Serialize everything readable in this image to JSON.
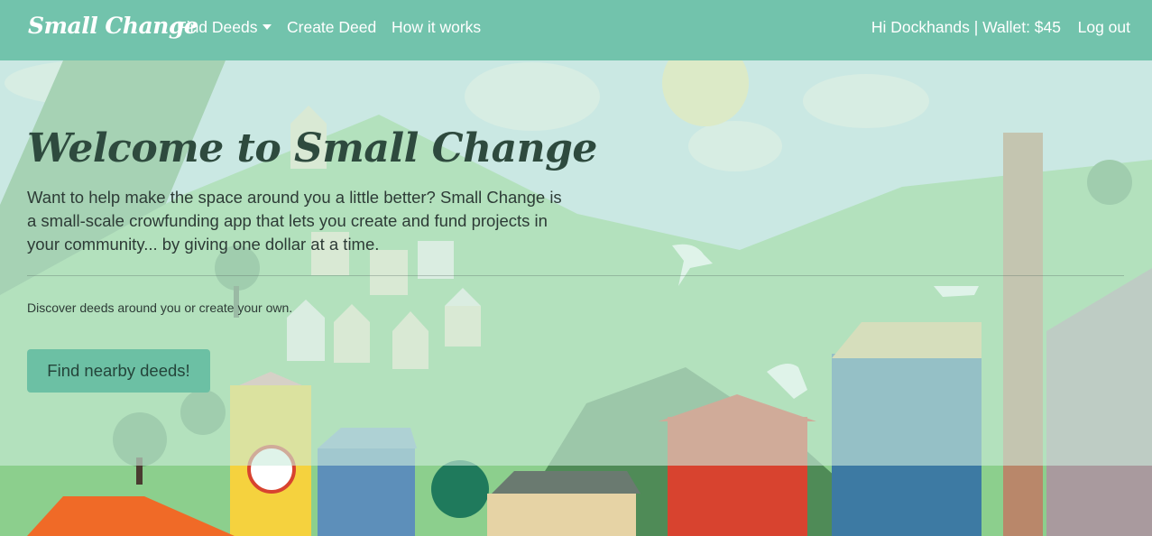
{
  "navbar": {
    "brand": "Small Change",
    "find_deeds": "Find Deeds",
    "create_deed": "Create Deed",
    "how_it_works": "How it works",
    "user_wallet": "Hi Dockhands | Wallet: $45",
    "logout": "Log out",
    "color": "#72c3ac"
  },
  "hero": {
    "title": "Welcome to Small Change",
    "lead": "Want to help make the space around you a little better? Small Change is a small-scale crowfunding app that lets you create and fund projects in your community... by giving one dollar at a time.",
    "sub": "Discover deeds around you or create your own.",
    "button": "Find nearby deeds!",
    "button_color": "#6cc0a4"
  }
}
